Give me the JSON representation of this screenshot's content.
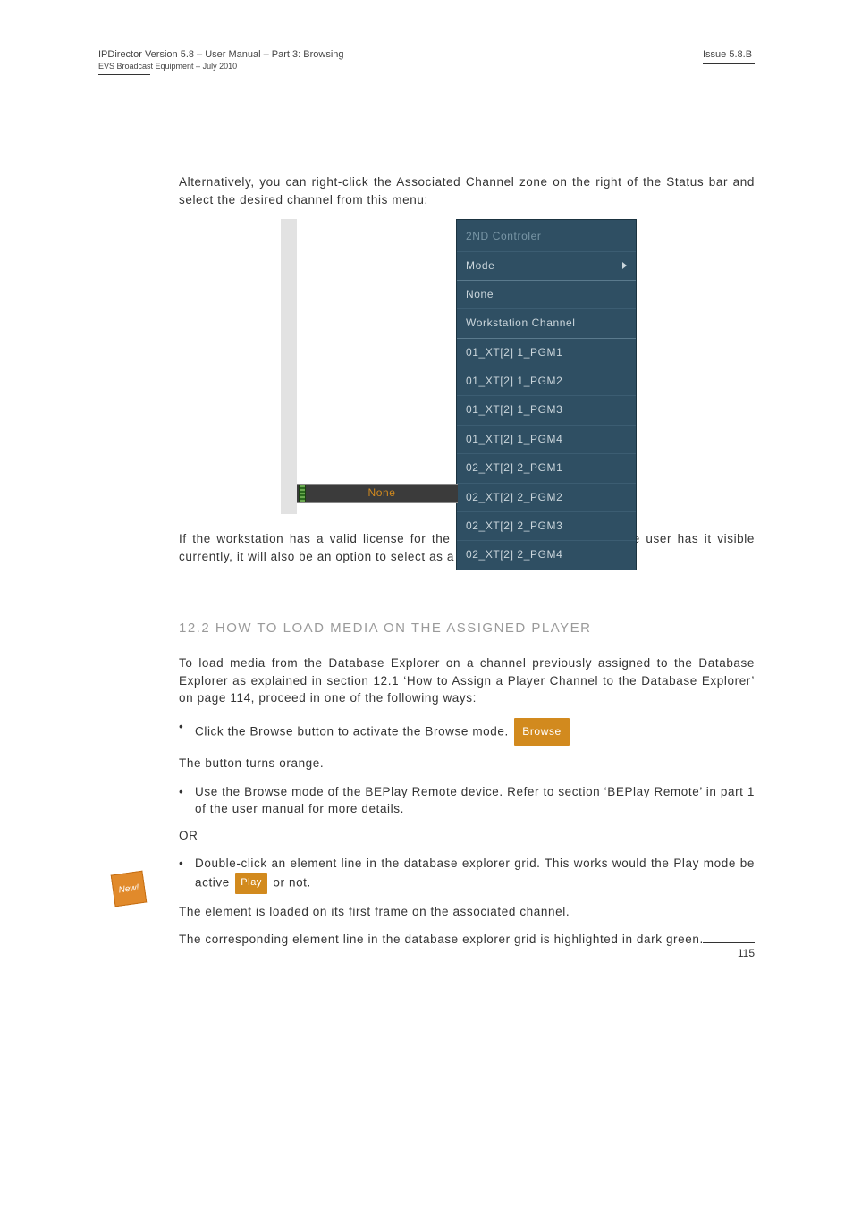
{
  "header": {
    "left_line1": "IPDirector Version 5.8 – User Manual – Part 3: Browsing",
    "left_line2": "EVS Broadcast Equipment – July 2010",
    "right": "Issue 5.8.B"
  },
  "body": {
    "p1": "Alternatively, you can right-click the Associated Channel zone on the right of the Status bar and select the desired channel from this menu:",
    "p2": "If the workstation has a valid license for the OCX Software Player, and the user has it visible currently, it will also be an option to select as a defined DB Explorer channel.",
    "heading": "12.2 HOW TO LOAD MEDIA ON THE ASSIGNED PLAYER",
    "p3": "To load media from the Database Explorer on a channel previously assigned to the Database Explorer as explained in section 12.1 ‘How to Assign a Player Channel to the Database Explorer’ on page 114, proceed in one of the following ways:",
    "b1": "Click the Browse button to activate the Browse mode.",
    "b1_sub": "The button turns orange.",
    "b2": "Use the Browse mode of the BEPlay Remote device. Refer to section ‘BEPlay Remote’ in part 1 of the user manual for more details.",
    "or": "OR",
    "b3_a": "Double-click an element line in the database explorer grid. This works would the Play mode be active",
    "b3_b": "or not.",
    "p4": "The element is loaded on its first frame on the associated channel.",
    "p5": "The corresponding element line in the database explorer grid is highlighted in dark green."
  },
  "buttons": {
    "browse": "Browse",
    "play": "Play"
  },
  "statusbar": {
    "label": "None"
  },
  "contextmenu": {
    "header": "2ND Controler",
    "mode": "Mode",
    "none": "None",
    "workstation": "Workstation Channel",
    "channels": [
      "01_XT[2] 1_PGM1",
      "01_XT[2] 1_PGM2",
      "01_XT[2] 1_PGM3",
      "01_XT[2] 1_PGM4",
      "02_XT[2] 2_PGM1",
      "02_XT[2] 2_PGM2",
      "02_XT[2] 2_PGM3",
      "02_XT[2] 2_PGM4"
    ]
  },
  "badge": {
    "text": "New!"
  },
  "footer": {
    "page": "115"
  }
}
